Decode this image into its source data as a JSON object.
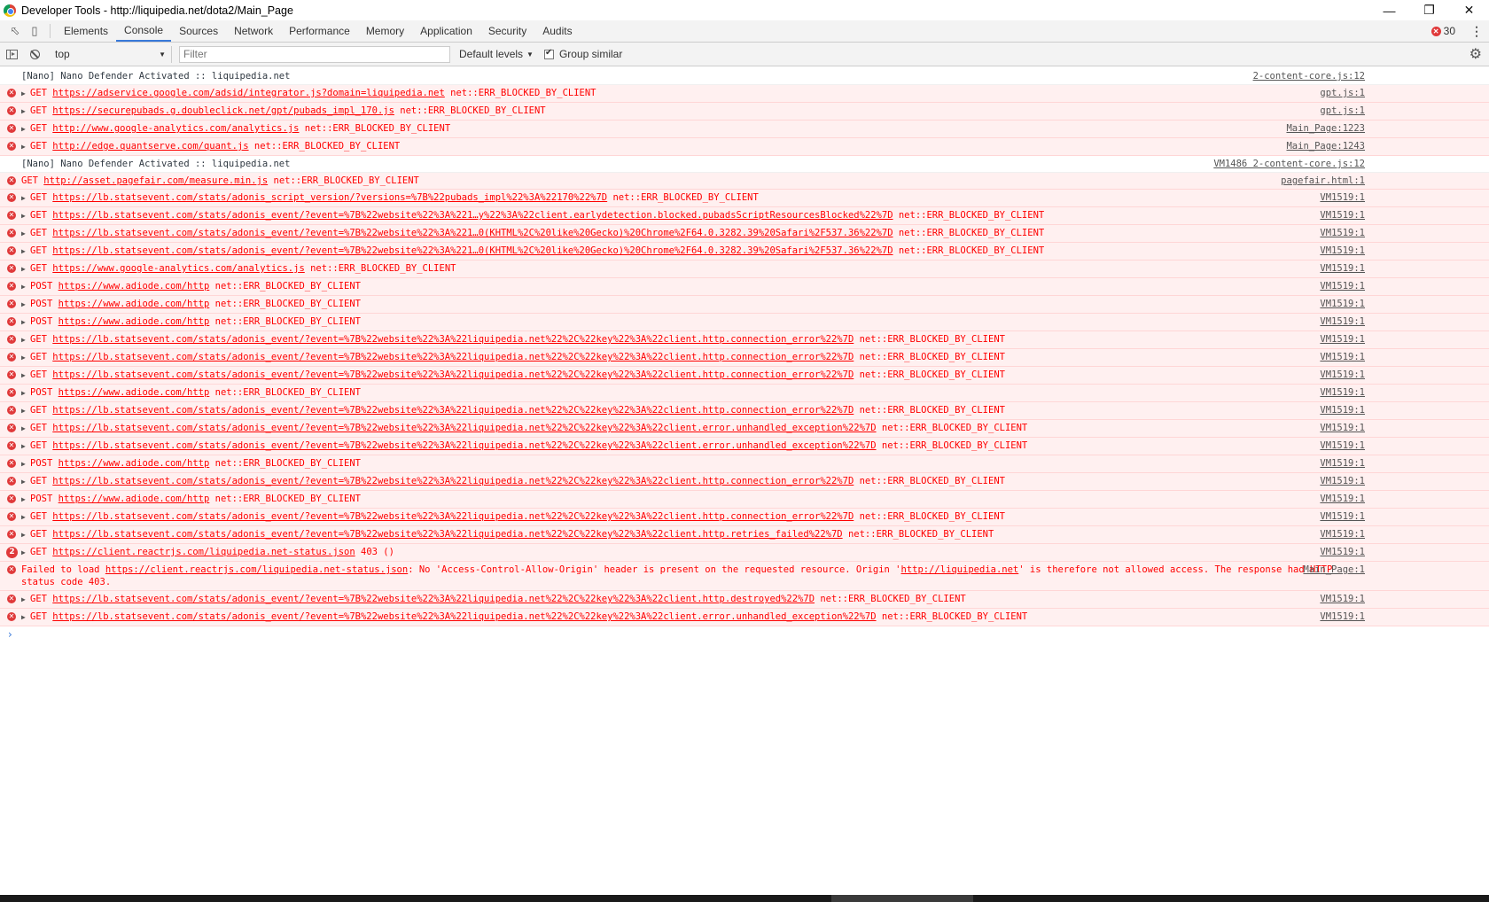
{
  "window": {
    "title": "Developer Tools - http://liquipedia.net/dota2/Main_Page",
    "minimize_icon": "minimize-icon",
    "restore_icon": "restore-icon",
    "close_icon": "close-icon"
  },
  "tabs": [
    {
      "label": "Elements"
    },
    {
      "label": "Console"
    },
    {
      "label": "Sources"
    },
    {
      "label": "Network"
    },
    {
      "label": "Performance"
    },
    {
      "label": "Memory"
    },
    {
      "label": "Application"
    },
    {
      "label": "Security"
    },
    {
      "label": "Audits"
    }
  ],
  "active_tab": "Console",
  "error_count": "30",
  "toolbar": {
    "context": "top",
    "filter_placeholder": "Filter",
    "levels": "Default levels",
    "group_similar": "Group similar"
  },
  "messages": [
    {
      "type": "info",
      "text": "[Nano] Nano Defender Activated :: liquipedia.net",
      "source": "2-content-core.js:12"
    },
    {
      "type": "error",
      "expand": true,
      "method": "GET",
      "url": "https://adservice.google.com/adsid/integrator.js?domain=liquipedia.net",
      "err": "net::ERR_BLOCKED_BY_CLIENT",
      "source": "gpt.js:1"
    },
    {
      "type": "error",
      "expand": true,
      "method": "GET",
      "url": "https://securepubads.g.doubleclick.net/gpt/pubads_impl_170.js",
      "err": "net::ERR_BLOCKED_BY_CLIENT",
      "source": "gpt.js:1"
    },
    {
      "type": "error",
      "expand": true,
      "method": "GET",
      "url": "http://www.google-analytics.com/analytics.js",
      "err": "net::ERR_BLOCKED_BY_CLIENT",
      "source": "Main_Page:1223"
    },
    {
      "type": "error",
      "expand": true,
      "method": "GET",
      "url": "http://edge.quantserve.com/quant.js",
      "err": "net::ERR_BLOCKED_BY_CLIENT",
      "source": "Main_Page:1243"
    },
    {
      "type": "info",
      "text": "[Nano] Nano Defender Activated :: liquipedia.net",
      "source": "VM1486 2-content-core.js:12"
    },
    {
      "type": "error",
      "expand": false,
      "method": "GET",
      "url": "http://asset.pagefair.com/measure.min.js",
      "err": "net::ERR_BLOCKED_BY_CLIENT",
      "source": "pagefair.html:1"
    },
    {
      "type": "error",
      "expand": true,
      "method": "GET",
      "url": "https://lb.statsevent.com/stats/adonis_script_version/?versions=%7B%22pubads_impl%22%3A%22170%22%7D",
      "err": "net::ERR_BLOCKED_BY_CLIENT",
      "source": "VM1519:1"
    },
    {
      "type": "error",
      "expand": true,
      "method": "GET",
      "url": "https://lb.statsevent.com/stats/adonis_event/?event=%7B%22website%22%3A%221…y%22%3A%22client.earlydetection.blocked.pubadsScriptResourcesBlocked%22%7D",
      "err": "net::ERR_BLOCKED_BY_CLIENT",
      "source": "VM1519:1"
    },
    {
      "type": "error",
      "expand": true,
      "method": "GET",
      "url": "https://lb.statsevent.com/stats/adonis_event/?event=%7B%22website%22%3A%221…0(KHTML%2C%20like%20Gecko)%20Chrome%2F64.0.3282.39%20Safari%2F537.36%22%7D",
      "err": "net::ERR_BLOCKED_BY_CLIENT",
      "source": "VM1519:1"
    },
    {
      "type": "error",
      "expand": true,
      "method": "GET",
      "url": "https://lb.statsevent.com/stats/adonis_event/?event=%7B%22website%22%3A%221…0(KHTML%2C%20like%20Gecko)%20Chrome%2F64.0.3282.39%20Safari%2F537.36%22%7D",
      "err": "net::ERR_BLOCKED_BY_CLIENT",
      "source": "VM1519:1"
    },
    {
      "type": "error",
      "expand": true,
      "method": "GET",
      "url": "https://www.google-analytics.com/analytics.js",
      "err": "net::ERR_BLOCKED_BY_CLIENT",
      "source": "VM1519:1"
    },
    {
      "type": "error",
      "expand": true,
      "method": "POST",
      "url": "https://www.adiode.com/http",
      "err": "net::ERR_BLOCKED_BY_CLIENT",
      "source": "VM1519:1"
    },
    {
      "type": "error",
      "expand": true,
      "method": "POST",
      "url": "https://www.adiode.com/http",
      "err": "net::ERR_BLOCKED_BY_CLIENT",
      "source": "VM1519:1"
    },
    {
      "type": "error",
      "expand": true,
      "method": "POST",
      "url": "https://www.adiode.com/http",
      "err": "net::ERR_BLOCKED_BY_CLIENT",
      "source": "VM1519:1"
    },
    {
      "type": "error",
      "expand": true,
      "method": "GET",
      "url": "https://lb.statsevent.com/stats/adonis_event/?event=%7B%22website%22%3A%22liquipedia.net%22%2C%22key%22%3A%22client.http.connection_error%22%7D",
      "err": "net::ERR_BLOCKED_BY_CLIENT",
      "source": "VM1519:1"
    },
    {
      "type": "error",
      "expand": true,
      "method": "GET",
      "url": "https://lb.statsevent.com/stats/adonis_event/?event=%7B%22website%22%3A%22liquipedia.net%22%2C%22key%22%3A%22client.http.connection_error%22%7D",
      "err": "net::ERR_BLOCKED_BY_CLIENT",
      "source": "VM1519:1"
    },
    {
      "type": "error",
      "expand": true,
      "method": "GET",
      "url": "https://lb.statsevent.com/stats/adonis_event/?event=%7B%22website%22%3A%22liquipedia.net%22%2C%22key%22%3A%22client.http.connection_error%22%7D",
      "err": "net::ERR_BLOCKED_BY_CLIENT",
      "source": "VM1519:1"
    },
    {
      "type": "error",
      "expand": true,
      "method": "POST",
      "url": "https://www.adiode.com/http",
      "err": "net::ERR_BLOCKED_BY_CLIENT",
      "source": "VM1519:1"
    },
    {
      "type": "error",
      "expand": true,
      "method": "GET",
      "url": "https://lb.statsevent.com/stats/adonis_event/?event=%7B%22website%22%3A%22liquipedia.net%22%2C%22key%22%3A%22client.http.connection_error%22%7D",
      "err": "net::ERR_BLOCKED_BY_CLIENT",
      "source": "VM1519:1"
    },
    {
      "type": "error",
      "expand": true,
      "method": "GET",
      "url": "https://lb.statsevent.com/stats/adonis_event/?event=%7B%22website%22%3A%22liquipedia.net%22%2C%22key%22%3A%22client.error.unhandled_exception%22%7D",
      "err": "net::ERR_BLOCKED_BY_CLIENT",
      "source": "VM1519:1"
    },
    {
      "type": "error",
      "expand": true,
      "method": "GET",
      "url": "https://lb.statsevent.com/stats/adonis_event/?event=%7B%22website%22%3A%22liquipedia.net%22%2C%22key%22%3A%22client.error.unhandled_exception%22%7D",
      "err": "net::ERR_BLOCKED_BY_CLIENT",
      "source": "VM1519:1"
    },
    {
      "type": "error",
      "expand": true,
      "method": "POST",
      "url": "https://www.adiode.com/http",
      "err": "net::ERR_BLOCKED_BY_CLIENT",
      "source": "VM1519:1"
    },
    {
      "type": "error",
      "expand": true,
      "method": "GET",
      "url": "https://lb.statsevent.com/stats/adonis_event/?event=%7B%22website%22%3A%22liquipedia.net%22%2C%22key%22%3A%22client.http.connection_error%22%7D",
      "err": "net::ERR_BLOCKED_BY_CLIENT",
      "source": "VM1519:1"
    },
    {
      "type": "error",
      "expand": true,
      "method": "POST",
      "url": "https://www.adiode.com/http",
      "err": "net::ERR_BLOCKED_BY_CLIENT",
      "source": "VM1519:1"
    },
    {
      "type": "error",
      "expand": true,
      "method": "GET",
      "url": "https://lb.statsevent.com/stats/adonis_event/?event=%7B%22website%22%3A%22liquipedia.net%22%2C%22key%22%3A%22client.http.connection_error%22%7D",
      "err": "net::ERR_BLOCKED_BY_CLIENT",
      "source": "VM1519:1"
    },
    {
      "type": "error",
      "expand": true,
      "method": "GET",
      "url": "https://lb.statsevent.com/stats/adonis_event/?event=%7B%22website%22%3A%22liquipedia.net%22%2C%22key%22%3A%22client.http.retries_failed%22%7D",
      "err": "net::ERR_BLOCKED_BY_CLIENT",
      "source": "VM1519:1"
    },
    {
      "type": "error",
      "expand": true,
      "count": "2",
      "method": "GET",
      "url": "https://client.reactrjs.com/liquipedia.net-status.json",
      "err": "403 ()",
      "source": "VM1519:1"
    },
    {
      "type": "error-cors",
      "prefix": "Failed to load ",
      "url": "https://client.reactrjs.com/liquipedia.net-status.json",
      "mid": ": No 'Access-Control-Allow-Origin' header is present on the requested resource. Origin '",
      "url2": "http://liquipedia.net",
      "suffix": "' is therefore not allowed access. The response had HTTP status code 403.",
      "source": "Main_Page:1"
    },
    {
      "type": "error",
      "expand": true,
      "method": "GET",
      "url": "https://lb.statsevent.com/stats/adonis_event/?event=%7B%22website%22%3A%22liquipedia.net%22%2C%22key%22%3A%22client.http.destroyed%22%7D",
      "err": "net::ERR_BLOCKED_BY_CLIENT",
      "source": "VM1519:1"
    },
    {
      "type": "error",
      "expand": true,
      "method": "GET",
      "url": "https://lb.statsevent.com/stats/adonis_event/?event=%7B%22website%22%3A%22liquipedia.net%22%2C%22key%22%3A%22client.error.unhandled_exception%22%7D",
      "err": "net::ERR_BLOCKED_BY_CLIENT",
      "source": "VM1519:1"
    }
  ],
  "prompt_symbol": "›",
  "colors": {
    "error_text": "#ff0000",
    "error_bg": "#fff0f0",
    "accent": "#3879d9",
    "error_badge": "#e0393a"
  }
}
